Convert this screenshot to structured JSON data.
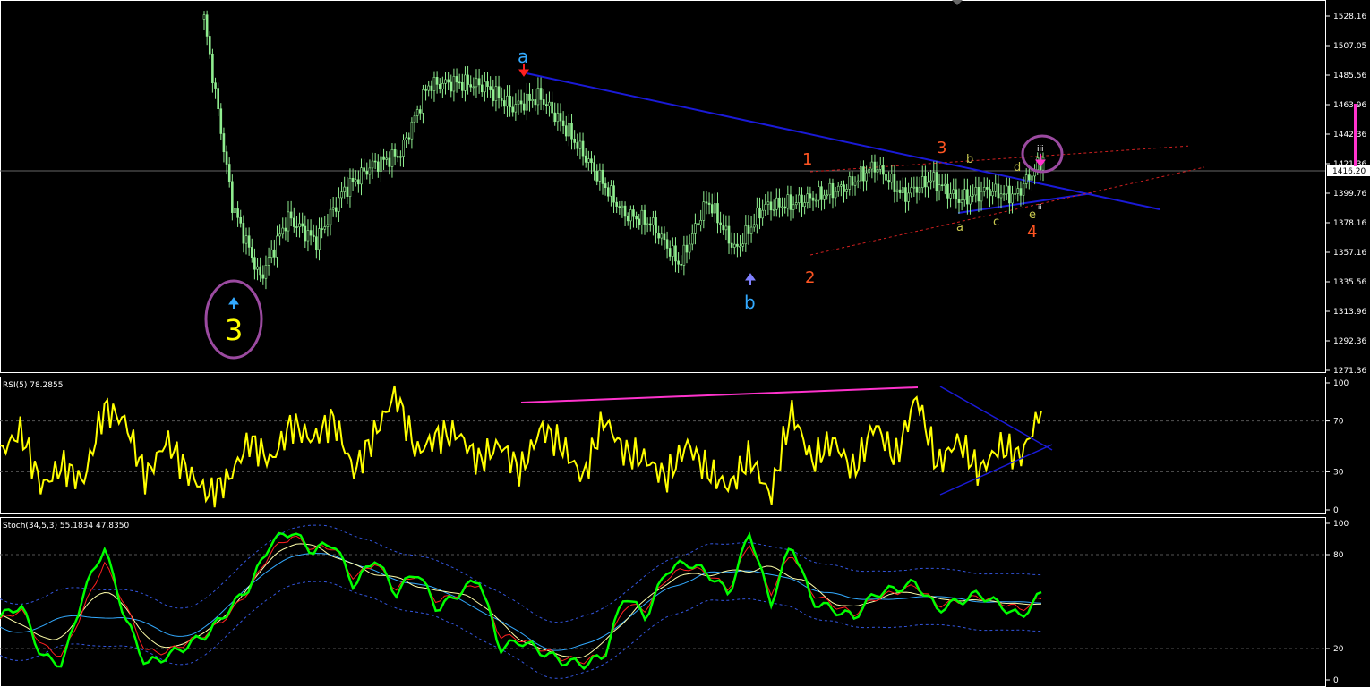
{
  "colors": {
    "background": "#000000",
    "axis": "#ffffff",
    "price_line": "#90ee90",
    "trend_line": "#1010c8",
    "channel": "#d02020",
    "rsi_line": "#ffff00",
    "divergence": "#ff33cc",
    "stoch_main": "#00ff00",
    "stoch_signal": "#ff2020",
    "stoch_slow": "#ffffaa",
    "stoch_slow2": "#33aaff",
    "stoch_band": "#3355dd",
    "circle": "#9b4aa0",
    "wave_blue": "#33aaff",
    "wave_orange": "#ff5522",
    "wave_yellow": "#ffff00",
    "wave_olive": "#c8c850"
  },
  "price_pane": {
    "ticks": [
      "1528.16",
      "1507.05",
      "1485.56",
      "1463.96",
      "1442.36",
      "1421.36",
      "1399.76",
      "1378.16",
      "1357.16",
      "1335.56",
      "1313.96",
      "1292.36",
      "1271.36"
    ],
    "current_price": "1416.20"
  },
  "rsi_pane": {
    "title": "RSI(5) 78.2855",
    "ticks": [
      "100",
      "70",
      "30",
      "0"
    ]
  },
  "stoch_pane": {
    "title": "Stoch(34,5,3) 55.1834 47.8350",
    "ticks": [
      "100",
      "80",
      "20",
      "0"
    ]
  },
  "wave_labels": {
    "big3": "3",
    "a_top": "a",
    "b_bottom": "b",
    "w1": "1",
    "w2": "2",
    "w3": "3",
    "w4": "4",
    "sub_a": "a",
    "sub_b": "b",
    "sub_c": "c",
    "sub_d": "d",
    "sub_e": "e",
    "sub_iii": "iii",
    "sub_ii": "ii"
  },
  "icons": {
    "up_arrow": "up-arrow-icon",
    "down_arrow": "down-arrow-icon"
  },
  "chart_data": [
    {
      "type": "line",
      "title": "",
      "ylim": [
        1271.36,
        1528.16
      ],
      "x": [
        0,
        5,
        10,
        15,
        20,
        25,
        30,
        35,
        40,
        45,
        50,
        55,
        60,
        65,
        70,
        75,
        80,
        85,
        90,
        95,
        100
      ],
      "series": [
        {
          "values": [
            1526,
            1392,
            1338,
            1382,
            1365,
            1402,
            1420,
            1428,
            1478,
            1480,
            1478,
            1462,
            1470,
            1445,
            1415,
            1385,
            1378,
            1348,
            1395,
            1358,
            1390,
            1392,
            1398,
            1405,
            1420,
            1398,
            1410,
            1395,
            1402,
            1398,
            1425
          ]
        }
      ]
    },
    {
      "type": "line",
      "title": "RSI(5) 78.2855",
      "ylim": [
        0,
        100
      ],
      "x": [
        0,
        2,
        4,
        6,
        8,
        10,
        12,
        14,
        16,
        18,
        20,
        22,
        24,
        26,
        28,
        30,
        32,
        34,
        36,
        38,
        40,
        42,
        44,
        46,
        48,
        50,
        52,
        54,
        56,
        58,
        60,
        62,
        64,
        66,
        68,
        70,
        72,
        74,
        76,
        78,
        80,
        82,
        84,
        86,
        88,
        90,
        92,
        94,
        96,
        98,
        100
      ],
      "series": [
        {
          "values": [
            45,
            62,
            18,
            35,
            22,
            80,
            70,
            25,
            55,
            30,
            12,
            25,
            55,
            38,
            68,
            55,
            72,
            30,
            60,
            92,
            45,
            58,
            60,
            38,
            52,
            30,
            65,
            50,
            25,
            72,
            45,
            40,
            25,
            52,
            30,
            18,
            42,
            10,
            78,
            38,
            55,
            30,
            68,
            40,
            90,
            35,
            55,
            30,
            50,
            42,
            78
          ]
        }
      ]
    },
    {
      "type": "line",
      "title": "Stoch(34,5,3) 55.1834 47.8350",
      "ylim": [
        0,
        100
      ],
      "x": [
        0,
        2,
        4,
        6,
        8,
        10,
        12,
        14,
        16,
        18,
        20,
        22,
        24,
        26,
        28,
        30,
        32,
        34,
        36,
        38,
        40,
        42,
        44,
        46,
        48,
        50,
        52,
        54,
        56,
        58,
        60,
        62,
        64,
        66,
        68,
        70,
        72,
        74,
        76,
        78,
        80,
        82,
        84,
        86,
        88,
        90,
        92,
        94,
        96,
        98,
        100
      ],
      "series": [
        {
          "name": "main",
          "values": [
            40,
            48,
            15,
            10,
            55,
            85,
            40,
            10,
            15,
            22,
            30,
            45,
            60,
            88,
            95,
            82,
            88,
            60,
            78,
            55,
            70,
            45,
            55,
            65,
            20,
            25,
            18,
            12,
            10,
            15,
            55,
            40,
            70,
            75,
            68,
            55,
            95,
            48,
            88,
            50,
            45,
            40,
            55,
            58,
            62,
            45,
            50,
            55,
            48,
            40,
            55
          ]
        },
        {
          "name": "signal",
          "values": [
            38,
            45,
            22,
            15,
            45,
            75,
            48,
            18,
            18,
            24,
            30,
            42,
            58,
            82,
            92,
            84,
            85,
            65,
            75,
            58,
            68,
            50,
            55,
            62,
            28,
            26,
            20,
            14,
            12,
            16,
            48,
            45,
            65,
            72,
            68,
            58,
            88,
            55,
            82,
            55,
            48,
            42,
            52,
            56,
            60,
            48,
            50,
            53,
            50,
            45,
            52
          ]
        }
      ]
    }
  ]
}
